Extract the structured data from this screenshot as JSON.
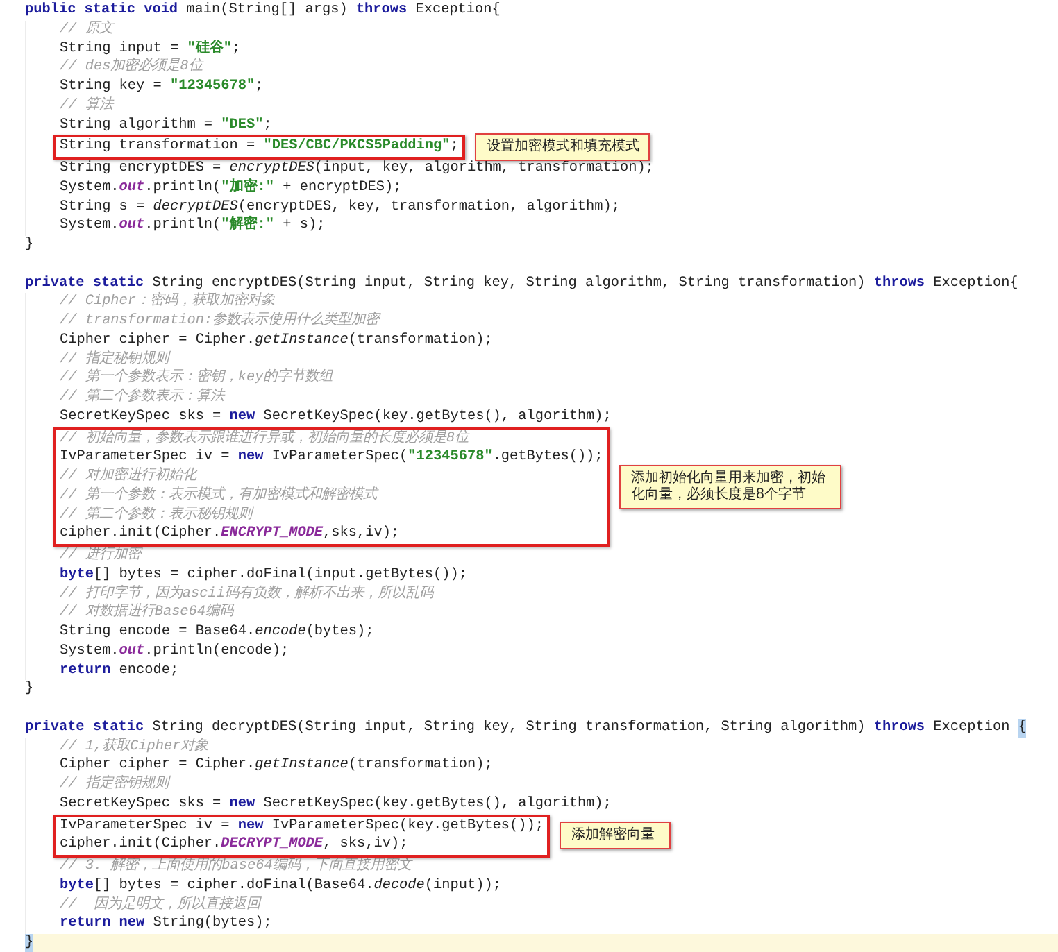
{
  "methods": [
    {
      "header": [
        {
          "kind": "kw",
          "text": "public static void"
        },
        {
          "kind": "text",
          "text": " main(String[] args) "
        },
        {
          "kind": "kw",
          "text": "throws"
        },
        {
          "kind": "text",
          "text": " Exception{"
        }
      ],
      "body": [
        {
          "kind": "plain",
          "lines": [
            [
              {
                "kind": "cmt",
                "text": "// 原文"
              }
            ],
            [
              {
                "kind": "text",
                "text": "String input = "
              },
              {
                "kind": "str",
                "text": "\"硅谷\""
              },
              {
                "kind": "text",
                "text": ";"
              }
            ],
            [
              {
                "kind": "cmt",
                "text": "// des加密必须是8位"
              }
            ],
            [
              {
                "kind": "text",
                "text": "String key = "
              },
              {
                "kind": "str",
                "text": "\"12345678\""
              },
              {
                "kind": "text",
                "text": ";"
              }
            ],
            [
              {
                "kind": "cmt",
                "text": "// 算法"
              }
            ],
            [
              {
                "kind": "text",
                "text": "String algorithm = "
              },
              {
                "kind": "str",
                "text": "\"DES\""
              },
              {
                "kind": "text",
                "text": ";"
              }
            ]
          ]
        },
        {
          "kind": "boxed",
          "note": "设置加密模式和填充模式",
          "lines": [
            [
              {
                "kind": "text",
                "text": "String transformation = "
              },
              {
                "kind": "str",
                "text": "\"DES/CBC/PKCS5Padding\""
              },
              {
                "kind": "text",
                "text": ";"
              }
            ]
          ]
        },
        {
          "kind": "plain",
          "lines": [
            [
              {
                "kind": "text",
                "text": "String encryptDES = "
              },
              {
                "kind": "call",
                "text": "encryptDES"
              },
              {
                "kind": "text",
                "text": "(input, key, algorithm, transformation);"
              }
            ],
            [
              {
                "kind": "text",
                "text": "System."
              },
              {
                "kind": "field",
                "text": "out"
              },
              {
                "kind": "text",
                "text": ".println("
              },
              {
                "kind": "str",
                "text": "\"加密:\""
              },
              {
                "kind": "text",
                "text": " + encryptDES);"
              }
            ],
            [
              {
                "kind": "text",
                "text": "String s = "
              },
              {
                "kind": "call",
                "text": "decryptDES"
              },
              {
                "kind": "text",
                "text": "(encryptDES, key, transformation, algorithm);"
              }
            ],
            [
              {
                "kind": "text",
                "text": "System."
              },
              {
                "kind": "field",
                "text": "out"
              },
              {
                "kind": "text",
                "text": ".println("
              },
              {
                "kind": "str",
                "text": "\"解密:\""
              },
              {
                "kind": "text",
                "text": " + s);"
              }
            ]
          ]
        }
      ],
      "closing": {
        "current": false,
        "tokens": [
          {
            "kind": "text",
            "text": "}"
          }
        ]
      }
    },
    {
      "header": [
        {
          "kind": "kw",
          "text": "private static"
        },
        {
          "kind": "text",
          "text": " String encryptDES(String input, String key, String algorithm, String transformation) "
        },
        {
          "kind": "kw",
          "text": "throws"
        },
        {
          "kind": "text",
          "text": " Exception{"
        }
      ],
      "body": [
        {
          "kind": "plain",
          "lines": [
            [
              {
                "kind": "cmt",
                "text": "// Cipher：密码，获取加密对象"
              }
            ],
            [
              {
                "kind": "cmt",
                "text": "// transformation:参数表示使用什么类型加密"
              }
            ],
            [
              {
                "kind": "text",
                "text": "Cipher cipher = Cipher."
              },
              {
                "kind": "call",
                "text": "getInstance"
              },
              {
                "kind": "text",
                "text": "(transformation);"
              }
            ],
            [
              {
                "kind": "cmt",
                "text": "// 指定秘钥规则"
              }
            ],
            [
              {
                "kind": "cmt",
                "text": "// 第一个参数表示：密钥，key的字节数组"
              }
            ],
            [
              {
                "kind": "cmt",
                "text": "// 第二个参数表示：算法"
              }
            ],
            [
              {
                "kind": "text",
                "text": "SecretKeySpec sks = "
              },
              {
                "kind": "kw",
                "text": "new"
              },
              {
                "kind": "text",
                "text": " SecretKeySpec(key.getBytes(), algorithm);"
              }
            ]
          ]
        },
        {
          "kind": "boxed",
          "note": "添加初始化向量用来加密，初始化向量，必须长度是8个字节",
          "lines": [
            [
              {
                "kind": "cmt",
                "text": "// 初始向量，参数表示跟谁进行异或，初始向量的长度必须是8位"
              }
            ],
            [
              {
                "kind": "text",
                "text": "IvParameterSpec iv = "
              },
              {
                "kind": "kw",
                "text": "new"
              },
              {
                "kind": "text",
                "text": " IvParameterSpec("
              },
              {
                "kind": "str",
                "text": "\"12345678\""
              },
              {
                "kind": "text",
                "text": ".getBytes());"
              }
            ],
            [
              {
                "kind": "cmt",
                "text": "// 对加密进行初始化"
              }
            ],
            [
              {
                "kind": "cmt",
                "text": "// 第一个参数：表示模式，有加密模式和解密模式"
              }
            ],
            [
              {
                "kind": "cmt",
                "text": "// 第二个参数：表示秘钥规则"
              }
            ],
            [
              {
                "kind": "text",
                "text": "cipher.init(Cipher."
              },
              {
                "kind": "field",
                "text": "ENCRYPT_MODE"
              },
              {
                "kind": "text",
                "text": ",sks,iv);"
              }
            ]
          ]
        },
        {
          "kind": "plain",
          "lines": [
            [
              {
                "kind": "cmt",
                "text": "// 进行加密"
              }
            ],
            [
              {
                "kind": "kw",
                "text": "byte"
              },
              {
                "kind": "text",
                "text": "[] bytes = cipher.doFinal(input.getBytes());"
              }
            ],
            [
              {
                "kind": "cmt",
                "text": "// 打印字节，因为ascii码有负数，解析不出来，所以乱码"
              }
            ],
            [
              {
                "kind": "cmt",
                "text": "// 对数据进行Base64编码"
              }
            ],
            [
              {
                "kind": "text",
                "text": "String encode = Base64."
              },
              {
                "kind": "call",
                "text": "encode"
              },
              {
                "kind": "text",
                "text": "(bytes);"
              }
            ],
            [
              {
                "kind": "text",
                "text": "System."
              },
              {
                "kind": "field",
                "text": "out"
              },
              {
                "kind": "text",
                "text": ".println(encode);"
              }
            ],
            [
              {
                "kind": "kw",
                "text": "return"
              },
              {
                "kind": "text",
                "text": " encode;"
              }
            ]
          ]
        }
      ],
      "closing": {
        "current": false,
        "tokens": [
          {
            "kind": "text",
            "text": "}"
          }
        ]
      }
    },
    {
      "header": [
        {
          "kind": "kw",
          "text": "private static"
        },
        {
          "kind": "text",
          "text": " String decryptDES(String input, String key, String transformation, String algorithm) "
        },
        {
          "kind": "kw",
          "text": "throws"
        },
        {
          "kind": "text",
          "text": " Exception "
        },
        {
          "kind": "match",
          "text": "{"
        }
      ],
      "body": [
        {
          "kind": "plain",
          "lines": [
            [
              {
                "kind": "cmt",
                "text": "// 1,获取Cipher对象"
              }
            ],
            [
              {
                "kind": "text",
                "text": "Cipher cipher = Cipher."
              },
              {
                "kind": "call",
                "text": "getInstance"
              },
              {
                "kind": "text",
                "text": "(transformation);"
              }
            ],
            [
              {
                "kind": "cmt",
                "text": "// 指定密钥规则"
              }
            ],
            [
              {
                "kind": "text",
                "text": "SecretKeySpec sks = "
              },
              {
                "kind": "kw",
                "text": "new"
              },
              {
                "kind": "text",
                "text": " SecretKeySpec(key.getBytes(), algorithm);"
              }
            ]
          ]
        },
        {
          "kind": "boxed",
          "note": "添加解密向量",
          "lines": [
            [
              {
                "kind": "text",
                "text": "IvParameterSpec iv = "
              },
              {
                "kind": "kw",
                "text": "new"
              },
              {
                "kind": "text",
                "text": " IvParameterSpec(key.getBytes());"
              }
            ],
            [
              {
                "kind": "text",
                "text": "cipher.init(Cipher."
              },
              {
                "kind": "field",
                "text": "DECRYPT_MODE"
              },
              {
                "kind": "text",
                "text": ", sks,iv);"
              }
            ]
          ]
        },
        {
          "kind": "plain",
          "lines": [
            [
              {
                "kind": "cmt",
                "text": "// 3. 解密，上面使用的base64编码，下面直接用密文"
              }
            ],
            [
              {
                "kind": "kw",
                "text": "byte"
              },
              {
                "kind": "text",
                "text": "[] bytes = cipher.doFinal(Base64."
              },
              {
                "kind": "call",
                "text": "decode"
              },
              {
                "kind": "text",
                "text": "(input));"
              }
            ],
            [
              {
                "kind": "cmt",
                "text": "//  因为是明文，所以直接返回"
              }
            ],
            [
              {
                "kind": "kw",
                "text": "return new"
              },
              {
                "kind": "text",
                "text": " String(bytes);"
              }
            ]
          ]
        }
      ],
      "closing": {
        "current": true,
        "tokens": [
          {
            "kind": "match",
            "text": "}"
          }
        ]
      }
    }
  ]
}
